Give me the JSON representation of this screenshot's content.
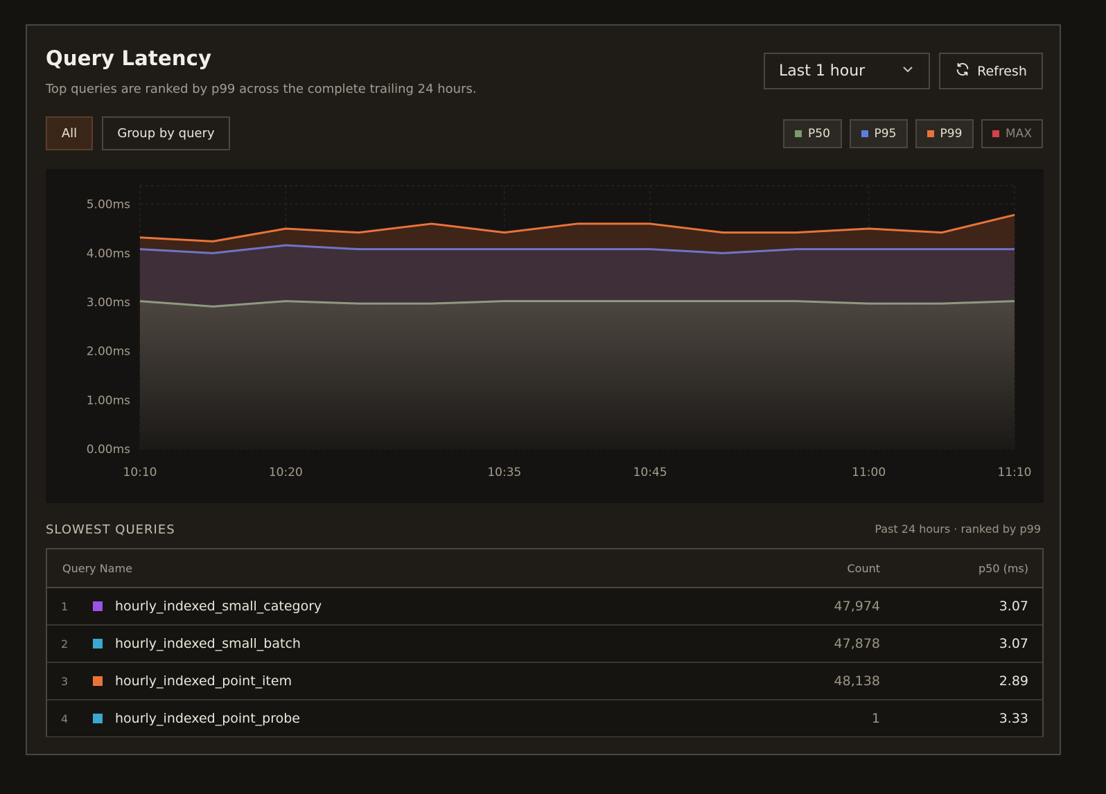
{
  "header": {
    "title": "Query Latency",
    "subtitle": "Top queries are ranked by p99 across the complete trailing 24 hours."
  },
  "controls": {
    "time_range": "Last 1 hour",
    "refresh_label": "Refresh",
    "filter_all": "All",
    "filter_group": "Group by query"
  },
  "legend": [
    {
      "label": "P50",
      "color": "#7f9a6a",
      "active": true
    },
    {
      "label": "P95",
      "color": "#5b7ee0",
      "active": true
    },
    {
      "label": "P99",
      "color": "#e8743a",
      "active": true
    },
    {
      "label": "MAX",
      "color": "#d4424a",
      "active": false
    }
  ],
  "chart_data": {
    "type": "area",
    "x": [
      "10:10",
      "10:15",
      "10:20",
      "10:25",
      "10:30",
      "10:35",
      "10:40",
      "10:45",
      "10:50",
      "10:55",
      "11:00",
      "11:05",
      "11:10"
    ],
    "x_ticks": [
      "10:10",
      "10:20",
      "10:35",
      "10:45",
      "11:00",
      "11:10"
    ],
    "y_ticks": [
      "0.00ms",
      "1.00ms",
      "2.00ms",
      "3.00ms",
      "4.00ms",
      "5.00ms"
    ],
    "ylim": [
      0,
      5.25
    ],
    "grid": true,
    "series": [
      {
        "name": "P50",
        "color": "#8e9a80",
        "values": [
          3.02,
          2.91,
          3.02,
          2.97,
          2.97,
          3.02,
          3.02,
          3.02,
          3.02,
          3.02,
          2.97,
          2.97,
          3.02
        ]
      },
      {
        "name": "P95",
        "color": "#6f74c8",
        "values": [
          4.08,
          4.0,
          4.16,
          4.08,
          4.08,
          4.08,
          4.08,
          4.08,
          4.0,
          4.08,
          4.08,
          4.08,
          4.08
        ]
      },
      {
        "name": "P99",
        "color": "#e8743a",
        "values": [
          4.32,
          4.24,
          4.5,
          4.42,
          4.6,
          4.42,
          4.6,
          4.6,
          4.42,
          4.42,
          4.5,
          4.42,
          4.78
        ]
      }
    ]
  },
  "slowest": {
    "title": "SLOWEST QUERIES",
    "meta": "Past 24 hours · ranked by p99",
    "columns": {
      "name": "Query Name",
      "count": "Count",
      "p50": "p50 (ms)"
    },
    "rows": [
      {
        "idx": "1",
        "name": "hourly_indexed_small_category",
        "color": "#9b52e6",
        "count": "47,974",
        "p50": "3.07"
      },
      {
        "idx": "2",
        "name": "hourly_indexed_small_batch",
        "color": "#3aa8d0",
        "count": "47,878",
        "p50": "3.07"
      },
      {
        "idx": "3",
        "name": "hourly_indexed_point_item",
        "color": "#e8743a",
        "count": "48,138",
        "p50": "2.89"
      },
      {
        "idx": "4",
        "name": "hourly_indexed_point_probe",
        "color": "#3aa8d0",
        "count": "1",
        "p50": "3.33"
      }
    ]
  }
}
